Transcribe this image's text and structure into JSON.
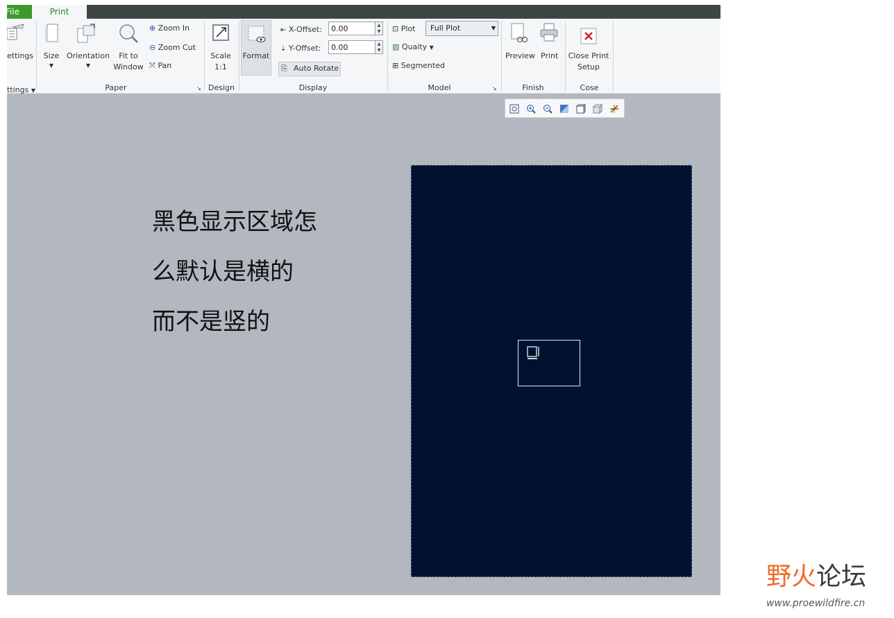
{
  "tabs": {
    "file": "File",
    "print": "Print"
  },
  "ribbon": {
    "settings": {
      "button_label": "ettings",
      "group_label": "ttings"
    },
    "paper": {
      "size_label": "Size",
      "orientation_label": "Orientation",
      "fit_label_1": "Fit to",
      "fit_label_2": "Window",
      "zoom_in": "Zoom In",
      "zoom_out": "Zoom Cut",
      "pan": "Pan",
      "group_label": "Paper"
    },
    "design": {
      "scale_1": "Scale",
      "scale_2": "1:1",
      "group_label": "Design"
    },
    "display": {
      "format_label": "Format",
      "x_offset_label": "X-Offset:",
      "x_offset_value": "0.00",
      "y_offset_label": "Y-Offset:",
      "y_offset_value": "0.00",
      "auto_rotate": "Auto Rotate",
      "group_label": "Display"
    },
    "model": {
      "plot_label": "Plot",
      "plot_value": "Full Plot",
      "quality_label": "Quaity",
      "segmented_label": "Segmented",
      "group_label": "Model"
    },
    "finish": {
      "preview": "Preview",
      "print": "Print",
      "group_label": "Finish"
    },
    "close": {
      "label_1": "Close Print",
      "label_2": "Setup",
      "group_label": "Cose"
    }
  },
  "view_toolbar": {
    "icons": [
      "zoom-fit-icon",
      "zoom-in-icon",
      "zoom-out-icon",
      "shading-icon",
      "view-box-icon",
      "named-views-icon",
      "spin-center-icon"
    ]
  },
  "annotation": {
    "line_1": "黑色显示区域怎",
    "line_2": "么默认是横的",
    "line_3": "而不是竖的"
  },
  "watermark": {
    "title_part_1": "野火",
    "title_part_2": "论坛",
    "url": "www.proewildfire.cn"
  },
  "colors": {
    "accent_green": "#3a9a2a",
    "paper_navy": "#011231",
    "canvas_gray": "#b3b7bf",
    "watermark_orange": "#f06a2a"
  }
}
